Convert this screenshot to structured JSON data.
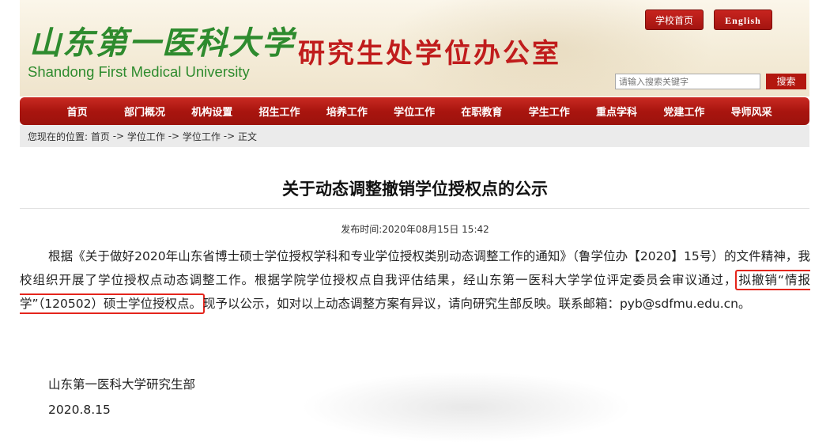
{
  "header": {
    "logo_cn": "山东第一医科大学",
    "logo_en": "Shandong First Medical University",
    "dept_title": "研究生处学位办公室",
    "btn_home": "学校首页",
    "btn_english": "English",
    "search_placeholder": "请输入搜索关键字",
    "search_button": "搜索"
  },
  "nav": {
    "items": [
      "首页",
      "部门概况",
      "机构设置",
      "招生工作",
      "培养工作",
      "学位工作",
      "在职教育",
      "学生工作",
      "重点学科",
      "党建工作",
      "导师风采"
    ]
  },
  "breadcrumb": {
    "prefix": "您现在的位置: ",
    "items": [
      "首页",
      "学位工作",
      "学位工作",
      "正文"
    ],
    "separator": " -> "
  },
  "article": {
    "title": "关于动态调整撤销学位授权点的公示",
    "publish_label": "发布时间:",
    "publish_time": "2020年08月15日 15:42",
    "para_before": "根据《关于做好2020年山东省博士硕士学位授权学科和专业学位授权类别动态调整工作的通知》（鲁学位办【2020】15号）的文件精神，我校组织开展了学位授权点动态调整工作。根据学院学位授权点自我评估结果，经山东第一医科大学学位评定委员会审议通过，",
    "para_highlight": "拟撤销“情报学”（120502）硕士学位授权点。",
    "para_after": "现予以公示，如对以上动态调整方案有异议，请向研究生部反映。联系邮箱：pyb@sdfmu.edu.cn。",
    "signature_org": "山东第一医科大学研究生部",
    "signature_date": "2020.8.15"
  },
  "colors": {
    "brand_red": "#b3170f",
    "logo_green": "#2e8b2e",
    "highlight_border": "#e4251c"
  }
}
